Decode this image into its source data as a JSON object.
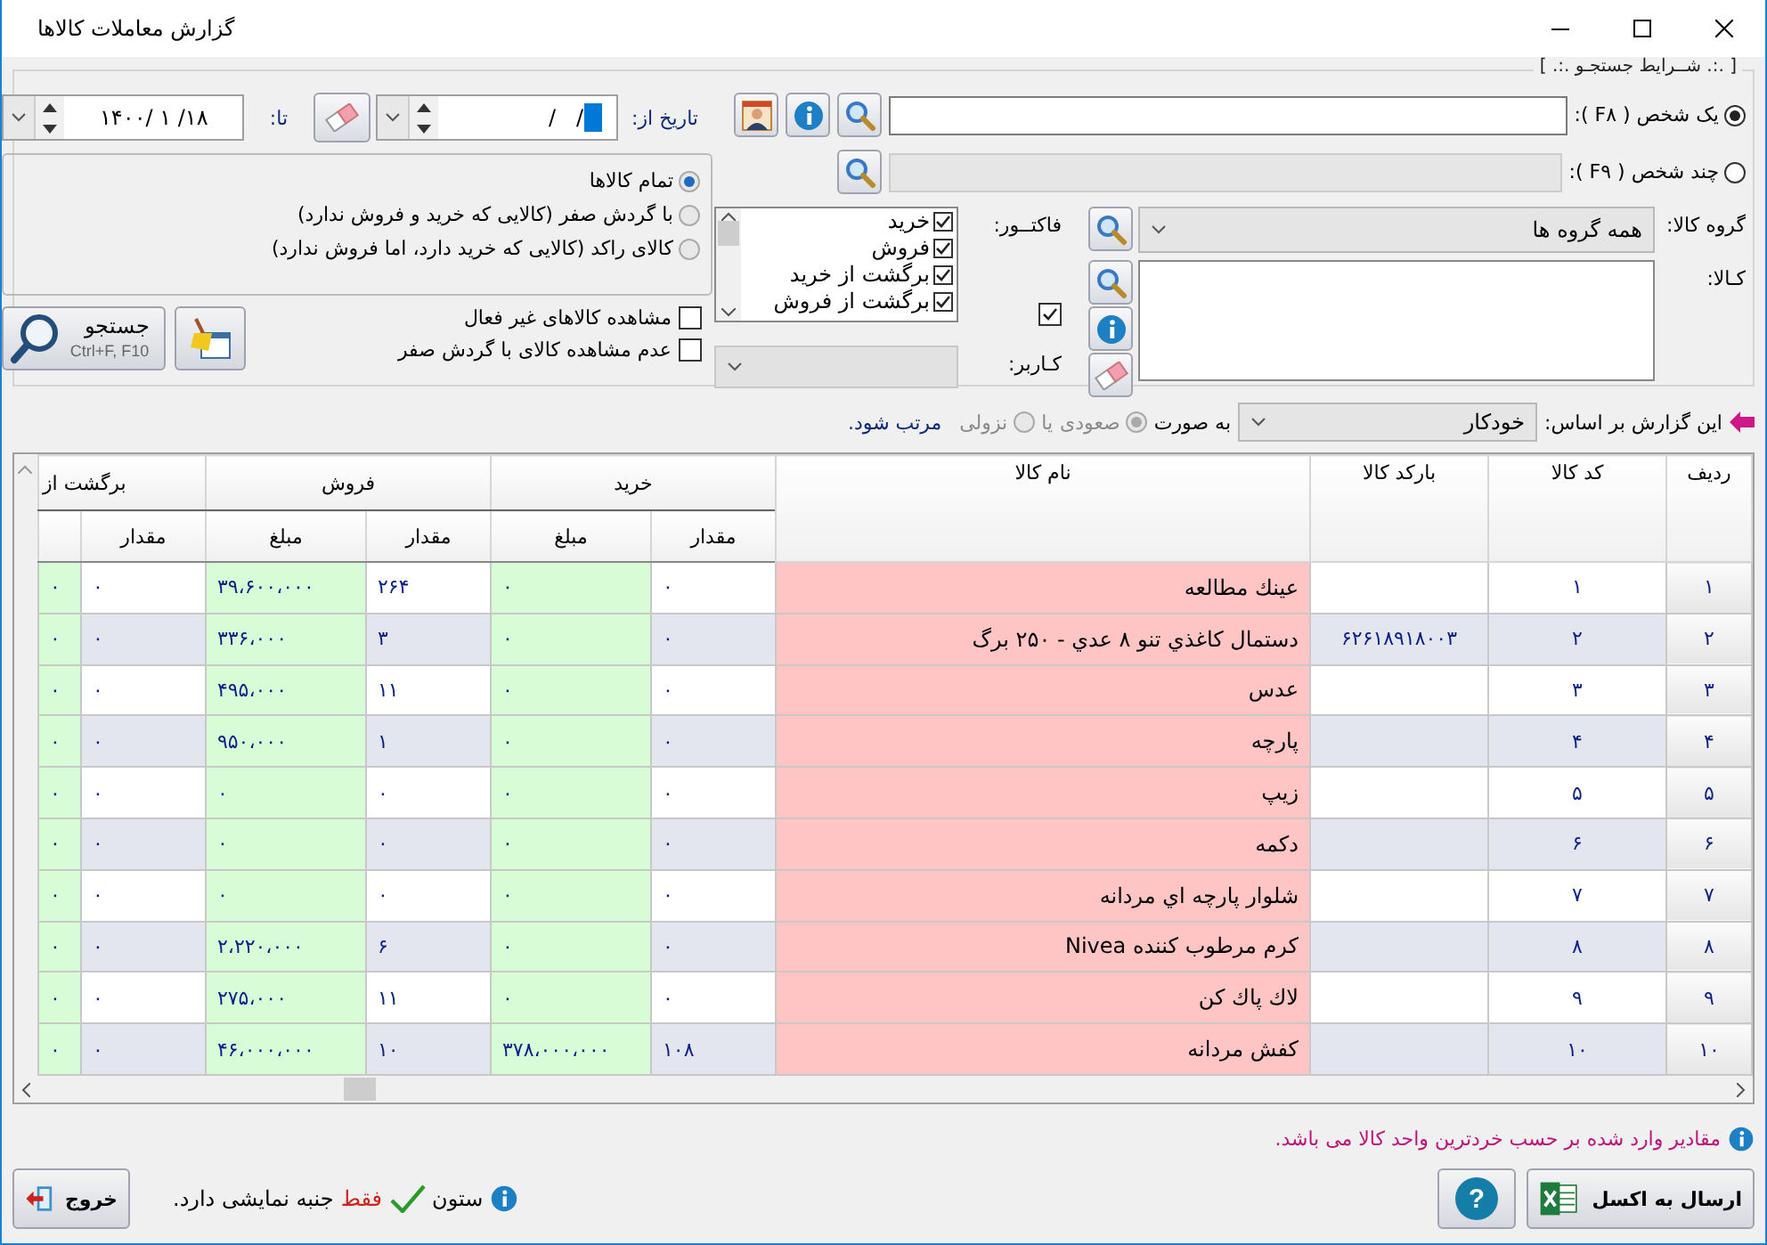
{
  "window": {
    "title": "گزارش معاملات کالاها"
  },
  "search": {
    "legend": "[ .:. شــرایط جستجـو .:. ]",
    "person_modes": [
      {
        "label": "یک شخص ( F۸ ):",
        "selected": true
      },
      {
        "label": "چند شخص ( F۹ ):",
        "selected": false
      }
    ],
    "goods_group": {
      "label": "گروه کالا:",
      "value": "همه گروه ها"
    },
    "goods": {
      "label": "کـالا:"
    },
    "invoice": {
      "label": "فاکتــور:",
      "all_checked": true,
      "types": [
        {
          "label": "خرید",
          "checked": true
        },
        {
          "label": "فروش",
          "checked": true
        },
        {
          "label": "برگشت از خرید",
          "checked": true
        },
        {
          "label": "برگشت از فروش",
          "checked": true
        }
      ]
    },
    "user": {
      "label": "کـاربر:",
      "disabled": true
    },
    "date_from": {
      "label": "تاریخ از:",
      "value": "/   /"
    },
    "date_to": {
      "label": "تا:",
      "value": "۱۴۰۰/ ۱ /۱۸"
    },
    "goods_filters": [
      {
        "label": "تمام کالاها",
        "selected": true
      },
      {
        "label": "با گردش صفر (کالایی که خرید و فروش ندارد)",
        "selected": false
      },
      {
        "label": "کالای راکد (کالایی که خرید دارد، اما فروش ندارد)",
        "selected": false
      }
    ],
    "options": [
      {
        "label": "مشاهده کالاهای غیر فعال",
        "checked": false
      },
      {
        "label": "عدم مشاهده کالای با گردش صفر",
        "checked": false
      }
    ],
    "search_button": {
      "label": "جستجو",
      "shortcut": "Ctrl+F, F10"
    }
  },
  "sort": {
    "label": "این گزارش بر اساس:",
    "value": "خودکار",
    "prefix": "به صورت",
    "joiner": "یا",
    "suffix": "مرتب شود.",
    "orders_disabled": true,
    "orders": [
      {
        "label": "صعودی",
        "selected": true
      },
      {
        "label": "نزولی",
        "selected": false
      }
    ]
  },
  "table": {
    "columns": [
      {
        "label": "ردیف",
        "kind": "index"
      },
      {
        "label": "کد کالا",
        "kind": "plain"
      },
      {
        "label": "بارکد کالا",
        "kind": "plain"
      },
      {
        "label": "نام کالا",
        "kind": "name"
      }
    ],
    "column_groups": [
      {
        "label": "خرید",
        "columns": [
          {
            "label": "مقدار",
            "kind": "plain"
          },
          {
            "label": "مبلغ",
            "kind": "amount"
          }
        ]
      },
      {
        "label": "فروش",
        "columns": [
          {
            "label": "مقدار",
            "kind": "plain"
          },
          {
            "label": "مبلغ",
            "kind": "amount"
          }
        ]
      },
      {
        "label": "برگشت از",
        "columns": [
          {
            "label": "مقدار",
            "kind": "plain"
          },
          {
            "kind": "amount"
          }
        ]
      }
    ],
    "rows": [
      [
        "۱",
        "۱",
        "",
        "عینك مطالعه",
        "۰",
        "۰",
        "۲۶۴",
        "۳۹،۶۰۰،۰۰۰",
        "۰",
        "۰"
      ],
      [
        "۲",
        "۲",
        "۶۲۶۱۸۹۱۸۰۰۳",
        "دستمال كاغذي تنو ۸ عدي - ۲۵۰ برگ",
        "۰",
        "۰",
        "۳",
        "۳۳۶،۰۰۰",
        "۰",
        "۰"
      ],
      [
        "۳",
        "۳",
        "",
        "عدس",
        "۰",
        "۰",
        "۱۱",
        "۴۹۵،۰۰۰",
        "۰",
        "۰"
      ],
      [
        "۴",
        "۴",
        "",
        "پارچه",
        "۰",
        "۰",
        "۱",
        "۹۵۰،۰۰۰",
        "۰",
        "۰"
      ],
      [
        "۵",
        "۵",
        "",
        "زيپ",
        "۰",
        "۰",
        "۰",
        "۰",
        "۰",
        "۰"
      ],
      [
        "۶",
        "۶",
        "",
        "دكمه",
        "۰",
        "۰",
        "۰",
        "۰",
        "۰",
        "۰"
      ],
      [
        "۷",
        "۷",
        "",
        "شلوار پارچه اي مردانه",
        "۰",
        "۰",
        "۰",
        "۰",
        "۰",
        "۰"
      ],
      [
        "۸",
        "۸",
        "",
        "كرم مرطوب كننده Nivea",
        "۰",
        "۰",
        "۶",
        "۲،۲۲۰،۰۰۰",
        "۰",
        "۰"
      ],
      [
        "۹",
        "۹",
        "",
        "لاك پاك كن",
        "۰",
        "۰",
        "۱۱",
        "۲۷۵،۰۰۰",
        "۰",
        "۰"
      ],
      [
        "۱۰",
        "۱۰",
        "",
        "كفش مردانه",
        "۱۰۸",
        "۳۷۸،۰۰۰،۰۰۰",
        "۱۰",
        "۴۶،۰۰۰،۰۰۰",
        "۰",
        "۰"
      ]
    ]
  },
  "note": "مقادیر وارد شده بر حسب خردترین واحد کالا می باشد.",
  "footer": {
    "excel_button": "ارسال به اکسل",
    "help_button": "?",
    "legend": {
      "before": "ستون",
      "highlight": "فقط",
      "after": "جنبه نمایشی دارد."
    },
    "exit_button": "خروج"
  }
}
